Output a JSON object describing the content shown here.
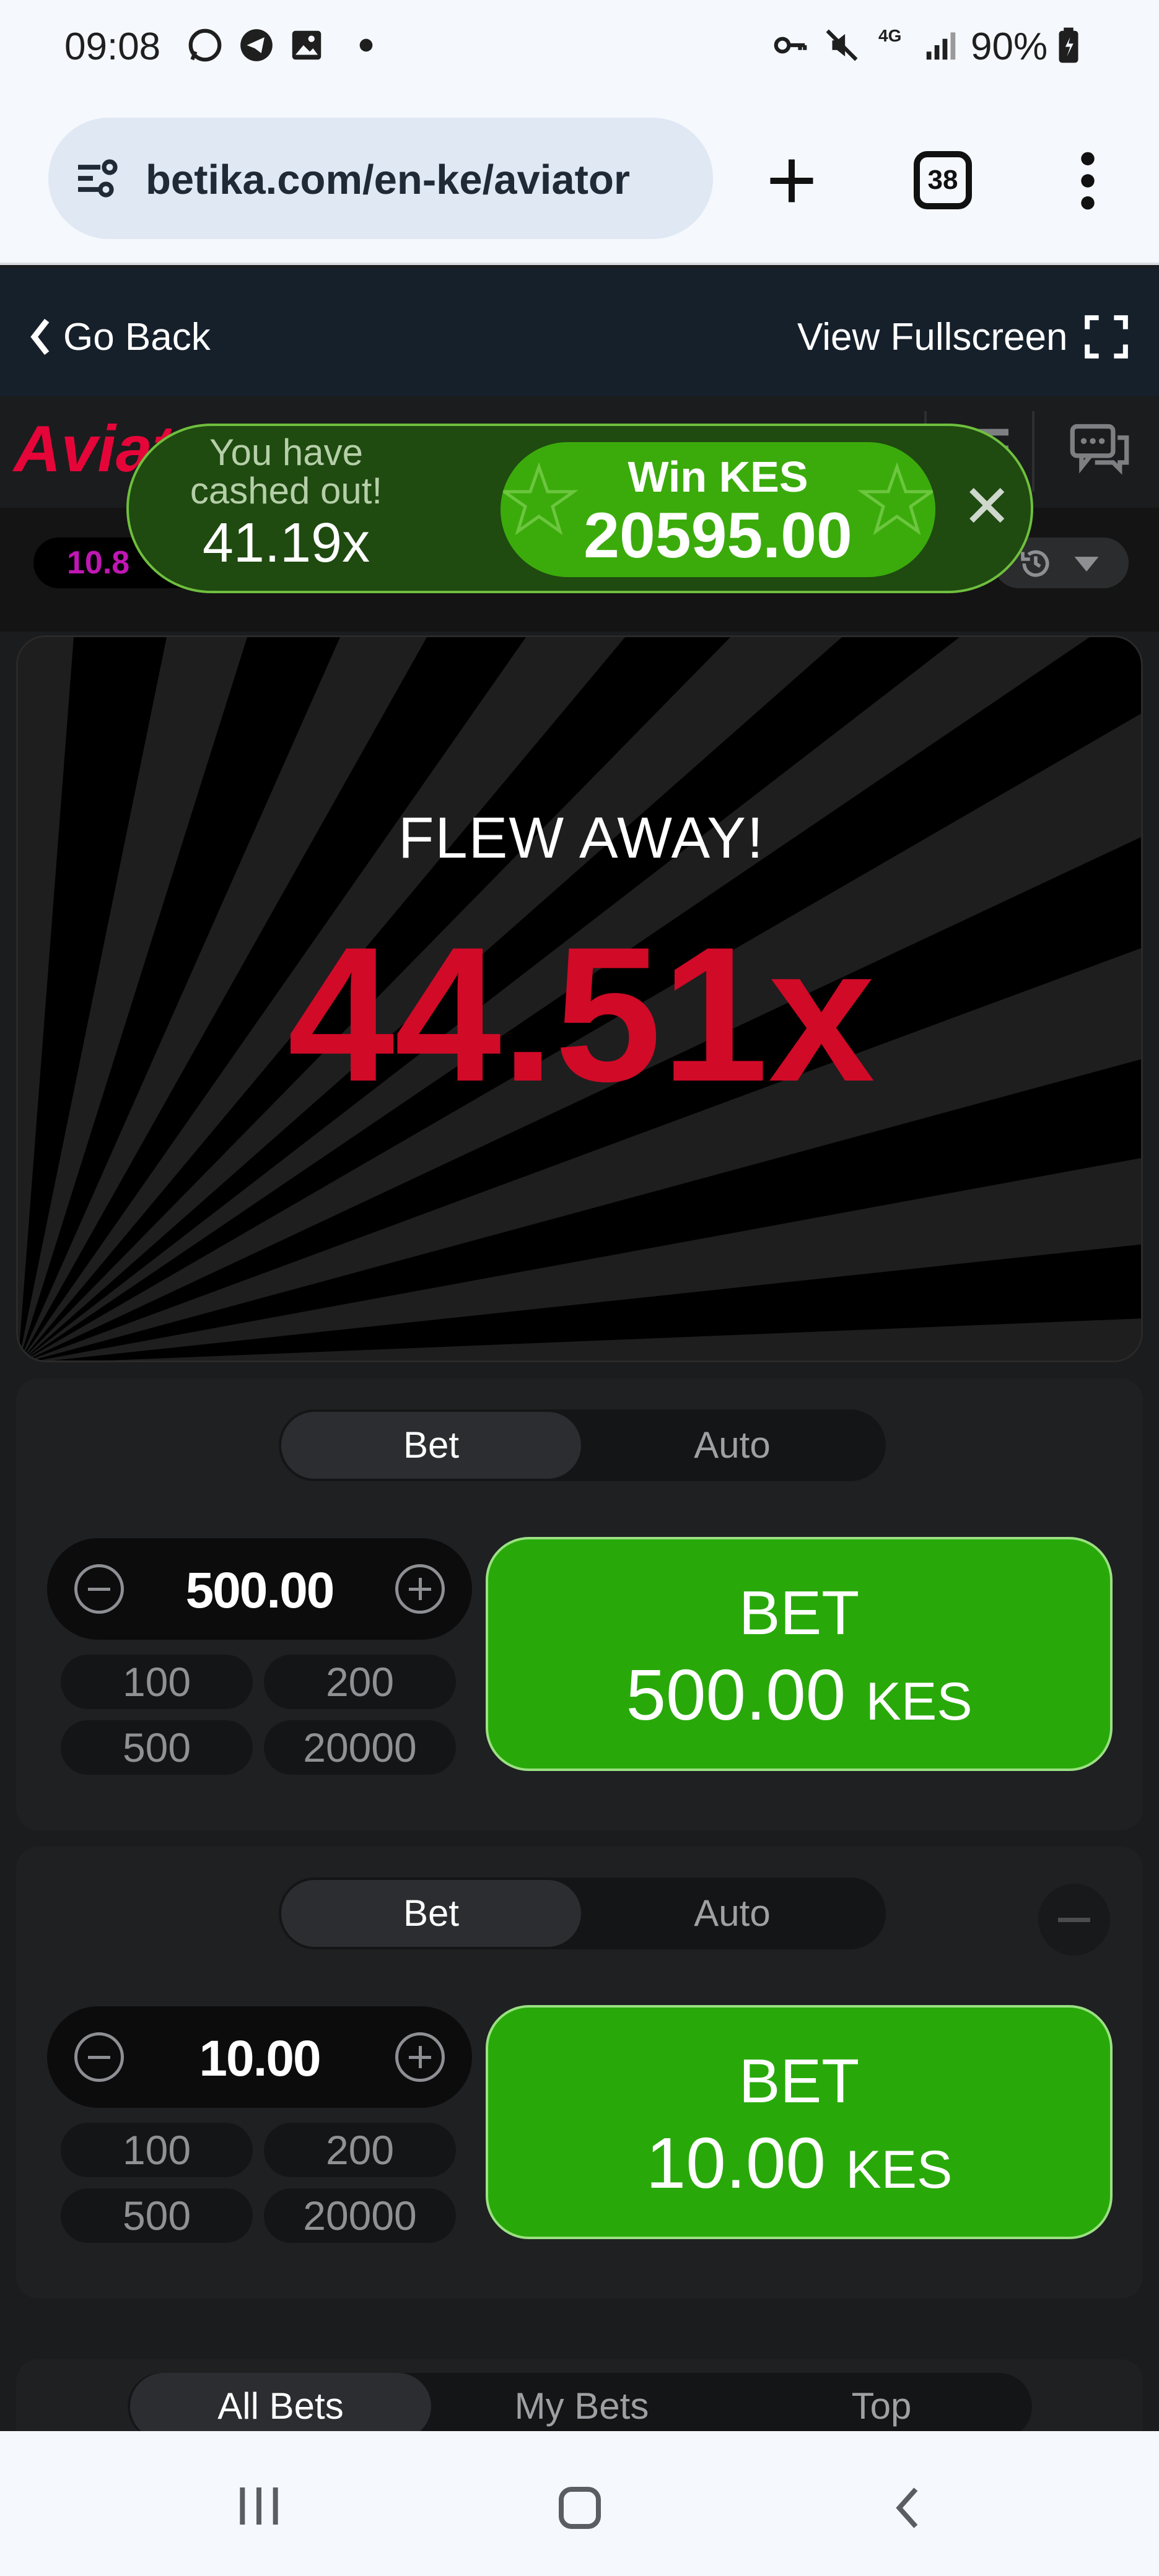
{
  "status_bar": {
    "time": "09:08",
    "network": "4G",
    "battery": "90%",
    "icons": [
      "whatsapp-icon",
      "telegram-icon",
      "gallery-icon",
      "dot-icon",
      "key-icon",
      "mute-icon",
      "signal-icon",
      "battery-icon"
    ]
  },
  "browser": {
    "url": "betika.com/en-ke/aviator",
    "tab_count": "38"
  },
  "game_header": {
    "back_label": "Go Back",
    "fullscreen_label": "View Fullscreen"
  },
  "game": {
    "logo_text": "Aviator",
    "history_first": "10.8",
    "toast": {
      "line1": "You have cashed out!",
      "multiplier": "41.19x",
      "win_label": "Win KES",
      "win_amount": "20595.00",
      "close": "✕"
    },
    "canvas": {
      "status": "FLEW AWAY!",
      "multiplier": "44.51x"
    }
  },
  "bet_panels": [
    {
      "tab_bet": "Bet",
      "tab_auto": "Auto",
      "amount": "500.00",
      "chips": [
        "100",
        "200",
        "500",
        "20000"
      ],
      "button_line1": "BET",
      "button_amount": "500.00",
      "button_currency": "KES"
    },
    {
      "tab_bet": "Bet",
      "tab_auto": "Auto",
      "amount": "10.00",
      "chips": [
        "100",
        "200",
        "500",
        "20000"
      ],
      "button_line1": "BET",
      "button_amount": "10.00",
      "button_currency": "KES"
    }
  ],
  "bets_tabs": [
    "All Bets",
    "My Bets",
    "Top"
  ],
  "colors": {
    "accent_green": "#28a909",
    "brand_red": "#e50539",
    "multiplier_red": "#d10a27",
    "history_purple": "#c017b4"
  }
}
